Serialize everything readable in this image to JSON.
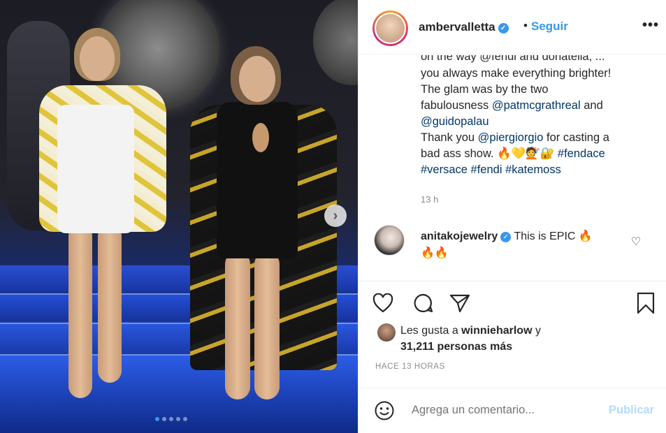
{
  "header": {
    "username": "ambervalletta",
    "verified_icon": "verified-badge-icon",
    "separator": "•",
    "follow_label": "Seguir",
    "more_label": "•••"
  },
  "caption": {
    "partial_line": "on the way @fendi and donatella, ...",
    "lines": [
      {
        "text": "you always make everything brighter!"
      },
      {
        "text": "The glam was by the two"
      },
      {
        "text": "fabulousness ",
        "tag": "@patmcgrathreal",
        "after": " and"
      },
      {
        "tag": "@guidopalau"
      },
      {
        "text": "Thank you ",
        "tag": "@piergiorgio",
        "after": " for casting a"
      },
      {
        "text": "bad ass show. 🔥💛💇🔐 ",
        "tag": "#fendace"
      },
      {
        "tag": "#versace #fendi #katemoss"
      }
    ],
    "time": "13 h"
  },
  "comment": {
    "username": "anitakojewelry",
    "verified_icon": "verified-badge-icon",
    "text": "This is EPIC 🔥",
    "text2": "🔥🔥"
  },
  "likes": {
    "prefix": "Les gusta a ",
    "user": "winnieharlow",
    "suffix": " y",
    "count_text": "31,211 personas más"
  },
  "posted": "HACE 13 HORAS",
  "compose": {
    "placeholder": "Agrega un comentario...",
    "publish_label": "Publicar"
  },
  "photo": {
    "alt": "Runway photo",
    "nav_arrow": "›",
    "dots_total": 5,
    "dots_active": 1
  },
  "colors": {
    "accent": "#3897f0",
    "publish_disabled": "#b3dbff",
    "muted": "#8e8e8e",
    "text": "#262626",
    "link": "#00376b"
  }
}
